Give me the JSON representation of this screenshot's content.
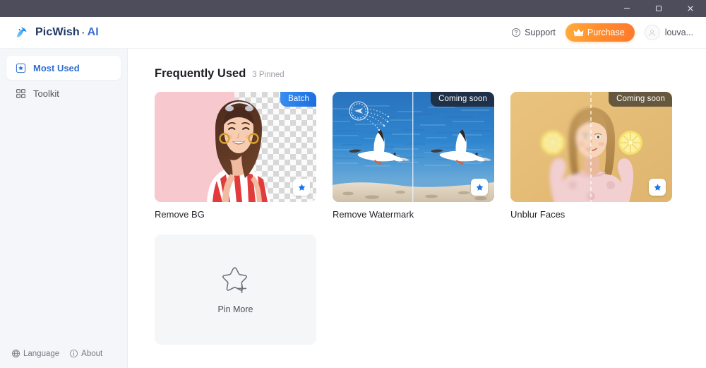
{
  "window": {
    "controls": [
      {
        "name": "minimize",
        "label": "Minimize"
      },
      {
        "name": "maximize",
        "label": "Maximize"
      },
      {
        "name": "close",
        "label": "Close"
      }
    ],
    "titlebar_color": "#4d4d5c"
  },
  "header": {
    "brand_name": "PicWish",
    "brand_separator": "·",
    "brand_suffix": "AI",
    "support_label": "Support",
    "support_icon": "question-circle-icon",
    "purchase_label": "Purchase",
    "purchase_icon": "crown-icon",
    "purchase_color": "#ff8a2b",
    "username": "louva...",
    "avatar_icon": "user-avatar-icon"
  },
  "sidebar": {
    "items": [
      {
        "label": "Most Used",
        "icon": "star-badge-icon",
        "active": true
      },
      {
        "label": "Toolkit",
        "icon": "grid-squares-icon",
        "active": false
      }
    ],
    "footer": [
      {
        "label": "Language",
        "icon": "globe-icon"
      },
      {
        "label": "About",
        "icon": "info-circle-icon"
      }
    ],
    "active_color": "#2f6fd0",
    "background": "#f5f6f9"
  },
  "main": {
    "section_title": "Frequently Used",
    "section_subtitle": "3 Pinned",
    "cards": [
      {
        "label": "Remove BG",
        "badge": "Batch",
        "badge_type": "batch",
        "pinned": true,
        "pin_icon": "star-filled-icon",
        "image": "woman-pink-background-transparent"
      },
      {
        "label": "Remove Watermark",
        "badge": "Coming soon",
        "badge_type": "soon",
        "pinned": true,
        "pin_icon": "star-filled-icon",
        "image": "seagull-over-sea-watermark-split"
      },
      {
        "label": "Unblur Faces",
        "badge": "Coming soon",
        "badge_type": "soon-warm",
        "pinned": true,
        "pin_icon": "star-filled-icon",
        "image": "girl-holding-lemons-blur-split"
      }
    ],
    "pin_more": {
      "label": "Pin More",
      "icon": "star-plus-outline-icon"
    }
  }
}
